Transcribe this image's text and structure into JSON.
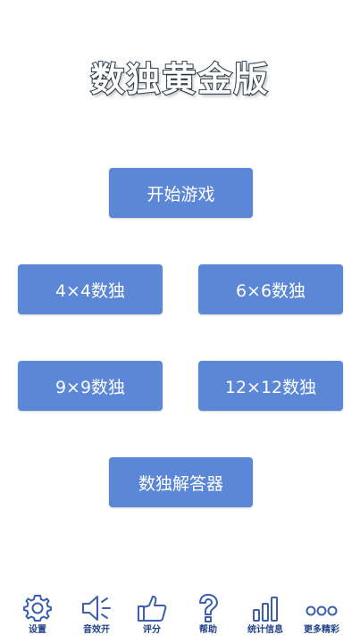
{
  "app": {
    "title": "数独黄金版"
  },
  "menu": {
    "start_label": "开始游戏",
    "sudoku4_label": "4×4数独",
    "sudoku6_label": "6×6数独",
    "sudoku9_label": "9×9数独",
    "sudoku12_label": "12×12数独",
    "solver_label": "数独解答器"
  },
  "bottom_bar": {
    "items": [
      {
        "label": "设置",
        "icon": "gear-icon"
      },
      {
        "label": "音效开",
        "icon": "speaker-icon"
      },
      {
        "label": "评分",
        "icon": "thumbs-up-icon"
      },
      {
        "label": "帮助",
        "icon": "question-icon"
      },
      {
        "label": "统计信息",
        "icon": "bar-chart-icon"
      },
      {
        "label": "更多精彩",
        "icon": "more-dots-icon"
      }
    ]
  },
  "colors": {
    "button_bg": "#5b87d6",
    "icon_stroke": "#3b5fad",
    "label_color": "#1f3f86"
  }
}
